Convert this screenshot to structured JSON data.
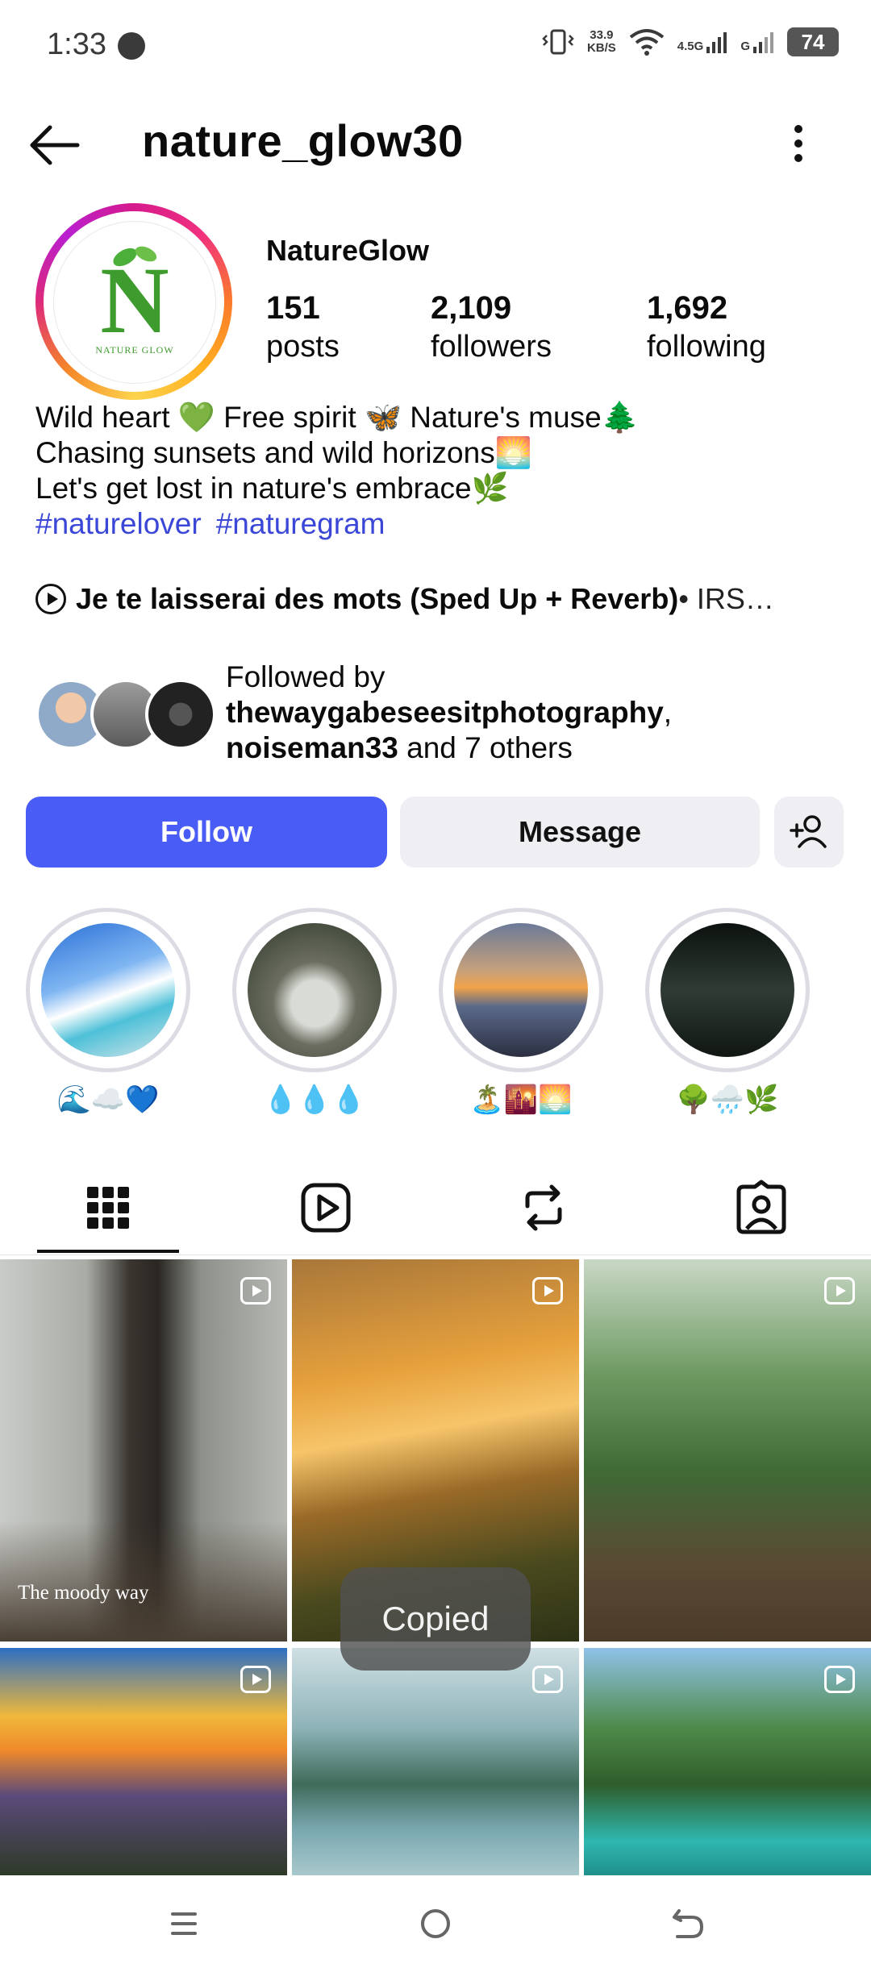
{
  "status_bar": {
    "time": "1:33",
    "net_speed_value": "33.9",
    "net_speed_unit": "KB/S",
    "network_1": "4.5G",
    "network_2": "G",
    "battery": "74"
  },
  "header": {
    "username": "nature_glow30"
  },
  "profile": {
    "display_name": "NatureGlow",
    "avatar_logo_letter": "N",
    "avatar_logo_text": "NATURE GLOW",
    "stats": [
      {
        "value": "151",
        "label": "posts"
      },
      {
        "value": "2,109",
        "label": "followers"
      },
      {
        "value": "1,692",
        "label": "following"
      }
    ],
    "bio": [
      "Wild heart 💚 Free spirit 🦋 Nature's muse🌲",
      "Chasing sunsets and wild horizons🌅",
      "Let's get lost in nature's embrace🌿"
    ],
    "hashtags": [
      "#naturelover",
      "#naturegram"
    ],
    "music": {
      "song": "Je te laisserai des mots (Sped Up + Reverb)",
      "artist": " • IRS…"
    },
    "followed_by": {
      "prefix": "Followed by",
      "user1": "thewaygabeseesitphotography",
      "user2": "noiseman33",
      "suffix": " and 7 others"
    }
  },
  "buttons": {
    "follow": "Follow",
    "message": "Message"
  },
  "highlights": [
    {
      "label": "🌊☁️💙"
    },
    {
      "label": "💧💧💧"
    },
    {
      "label": "🏝️🌇🌅"
    },
    {
      "label": "🌳🌧️🌿"
    }
  ],
  "tabs": [
    "grid-icon",
    "reels-icon",
    "reposts-icon",
    "tagged-icon"
  ],
  "grid": {
    "tile1_caption": "The moody way"
  },
  "toast": "Copied",
  "colors": {
    "follow_button": "#4a5cf6",
    "hashtag": "#3b47d6",
    "secondary_button": "#efeff3"
  }
}
